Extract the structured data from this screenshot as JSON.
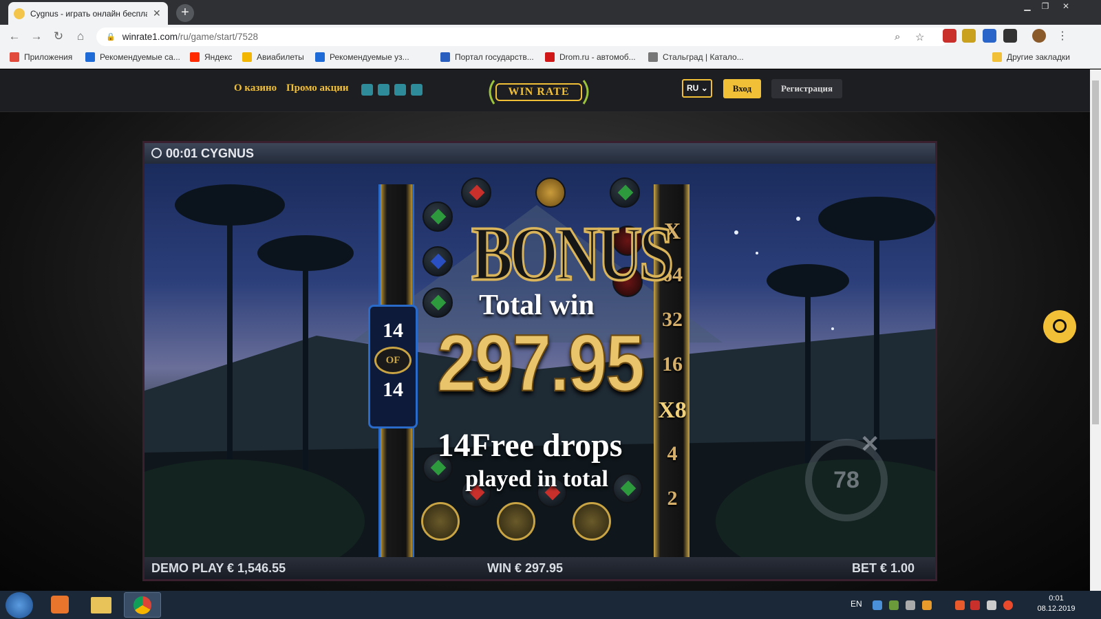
{
  "browser": {
    "tab_title": "Cygnus - играть онлайн бесплат",
    "url_host": "winrate1.com",
    "url_path": "/ru/game/start/7528"
  },
  "bookmarks": [
    {
      "label": "Приложения",
      "color": "#e24a3b"
    },
    {
      "label": "Рекомендуемые са...",
      "color": "#1e6ad6"
    },
    {
      "label": "Яндекс",
      "color": "#ff2a00"
    },
    {
      "label": "Авиабилеты",
      "color": "#f2b600"
    },
    {
      "label": "Рекомендуемые уз...",
      "color": "#1e6ad6"
    },
    {
      "label": "Портал государств...",
      "color": "#2b5fbf"
    },
    {
      "label": "Drom.ru - автомоб...",
      "color": "#d11818"
    },
    {
      "label": "Стальград | Катало...",
      "color": "#777777"
    }
  ],
  "other_bookmarks": "Другие закладки",
  "site": {
    "nav": [
      "О казино",
      "Промо акции"
    ],
    "logo": "WIN RATE",
    "lang": "RU",
    "login": "Вход",
    "register": "Регистрация",
    "accent": "#f2c037"
  },
  "game": {
    "header": "00:01 CYGNUS",
    "bonus_word": "BONUS",
    "total_win_label": "Total win",
    "amount": "297.95",
    "drops_line": "14Free drops",
    "played_line": "played in total",
    "counter_top": "14",
    "counter_of": "OF",
    "counter_bottom": "14",
    "multipliers": [
      "X",
      "64",
      "32",
      "16",
      "X8",
      "4",
      "2"
    ],
    "timer_value": "78",
    "demo": "DEMO PLAY € 1,546.55",
    "win": "WIN € 297.95",
    "bet": "BET € 1.00"
  },
  "taskbar": {
    "lang": "EN",
    "time": "0:01",
    "date": "08.12.2019"
  }
}
